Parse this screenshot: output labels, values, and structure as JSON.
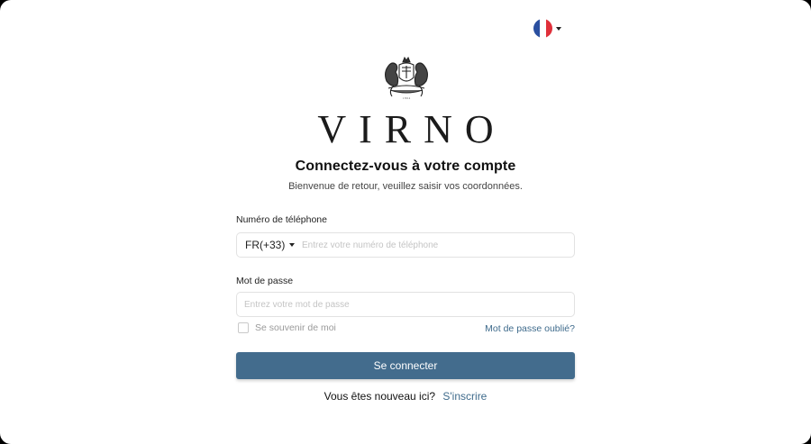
{
  "language": {
    "flag_colors": [
      "#2a4fa0",
      "#ffffff",
      "#e0303a"
    ],
    "icon": "flag-france-icon"
  },
  "brand": {
    "name": "VIRNO",
    "crest_icon": "royal-crest-icon"
  },
  "header": {
    "title": "Connectez-vous à votre compte",
    "subtitle": "Bienvenue de retour, veuillez saisir vos coordonnées."
  },
  "phone": {
    "label": "Numéro de téléphone",
    "country_code": "FR(+33)",
    "placeholder": "Entrez votre numéro de téléphone",
    "value": ""
  },
  "password": {
    "label": "Mot de passe",
    "placeholder": "Entrez votre mot de passe",
    "value": ""
  },
  "remember": {
    "label": "Se souvenir de moi",
    "checked": false
  },
  "forgot_label": "Mot de passe oublié?",
  "submit_label": "Se connecter",
  "signup": {
    "prompt": "Vous êtes nouveau ici?",
    "link_label": "S'inscrire"
  },
  "colors": {
    "accent": "#436c8d",
    "link": "#3f6b8c"
  }
}
